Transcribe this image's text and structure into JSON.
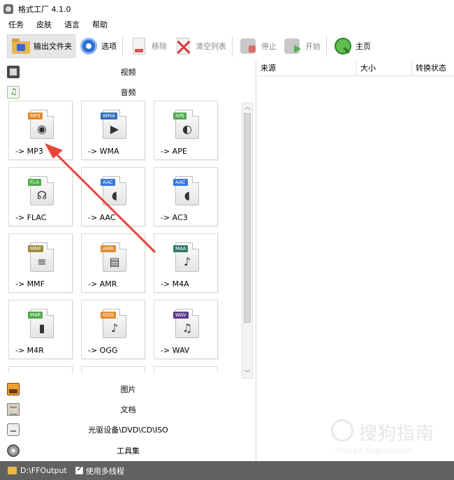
{
  "window": {
    "title": "格式工厂 4.1.0"
  },
  "menu": [
    "任务",
    "皮肤",
    "语言",
    "帮助"
  ],
  "toolbar": {
    "output_folder": "输出文件夹",
    "options": "选项",
    "remove": "移除",
    "clear_list": "清空列表",
    "stop": "停止",
    "start": "开始",
    "home": "主页"
  },
  "categories": {
    "video": "视频",
    "audio": "音频",
    "picture": "图片",
    "document": "文档",
    "disc": "光驱设备\\DVD\\CD\\ISO",
    "tools": "工具集"
  },
  "formats": [
    {
      "tag": "MP3",
      "label": "-> MP3",
      "tag_color": "#e08a2a",
      "icon": "speaker-icon"
    },
    {
      "tag": "WMA",
      "label": "-> WMA",
      "tag_color": "#2f6fb8",
      "icon": "play-icon"
    },
    {
      "tag": "APE",
      "label": "-> APE",
      "tag_color": "#4fa94a",
      "icon": "monkey-icon"
    },
    {
      "tag": "FLA",
      "label": "-> FLAC",
      "tag_color": "#4fa94a",
      "icon": "headphones-icon"
    },
    {
      "tag": "AAC",
      "label": "-> AAC",
      "tag_color": "#3a76d8",
      "icon": "audio-wave-icon"
    },
    {
      "tag": "AAC",
      "label": "-> AC3",
      "tag_color": "#3a76d8",
      "icon": "audio-wave-icon"
    },
    {
      "tag": "MMF",
      "label": "-> MMF",
      "tag_color": "#a08a3a",
      "icon": "document-icon"
    },
    {
      "tag": "AMR",
      "label": "-> AMR",
      "tag_color": "#e08a2a",
      "icon": "keyboard-icon"
    },
    {
      "tag": "M4A",
      "label": "-> M4A",
      "tag_color": "#2f7a6a",
      "icon": "music-note-icon"
    },
    {
      "tag": "M4R",
      "label": "-> M4R",
      "tag_color": "#4fa94a",
      "icon": "phone-icon"
    },
    {
      "tag": "OGG",
      "label": "-> OGG",
      "tag_color": "#e08a2a",
      "icon": "music-note-icon"
    },
    {
      "tag": "WAV",
      "label": "-> WAV",
      "tag_color": "#5a3a8a",
      "icon": "music-notes-icon"
    }
  ],
  "list_columns": [
    "来源",
    "大小",
    "转换状态"
  ],
  "status": {
    "output_path": "D:\\FFOutput",
    "multithread_label": "使用多线程",
    "multithread": true
  },
  "watermark": {
    "text": "搜狗指南",
    "sub": "zhinan.sogou.com"
  }
}
